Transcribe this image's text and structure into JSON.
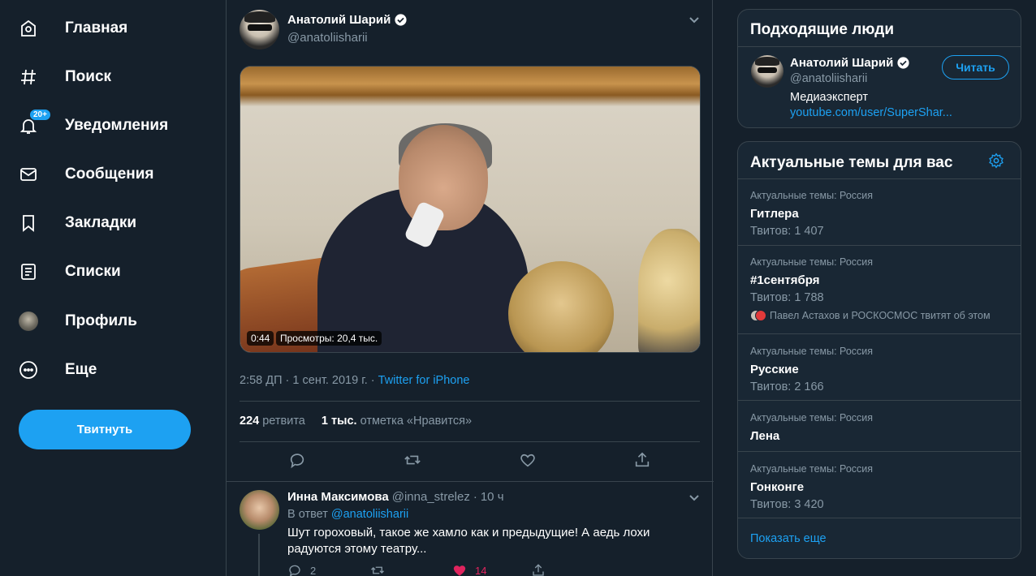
{
  "nav": {
    "home": "Главная",
    "explore": "Поиск",
    "notifications": "Уведомления",
    "notifications_badge": "20+",
    "messages": "Сообщения",
    "bookmarks": "Закладки",
    "lists": "Списки",
    "profile": "Профиль",
    "more": "Еще",
    "tweet_button": "Твитнуть"
  },
  "tweet": {
    "author_name": "Анатолий Шарий",
    "author_handle": "@anatoliisharii",
    "video_duration": "0:44",
    "video_views": "Просмотры: 20,4 тыс.",
    "time": "2:58 ДП",
    "date": "1 сент. 2019 г.",
    "separator": "·",
    "client": "Twitter for iPhone",
    "retweets_count": "224",
    "retweets_label": "ретвита",
    "likes_count": "1 тыс.",
    "likes_label": "отметка «Нравится»"
  },
  "reply": {
    "name": "Инна Максимова",
    "handle": "@inna_strelez",
    "dot": "·",
    "age": "10 ч",
    "in_reply_prefix": "В ответ",
    "in_reply_handle": "@anatoliisharii",
    "text": "Шут гороховый, такое же хамло как и предыдущие! А аедь лохи радуются этому театру...",
    "reply_count": "2",
    "like_count": "14"
  },
  "who_to_follow": {
    "title": "Подходящие люди",
    "name": "Анатолий Шарий",
    "handle": "@anatoliisharii",
    "follow_label": "Читать",
    "bio": "Медиаэксперт",
    "link": "youtube.com/user/SuperShar..."
  },
  "trends": {
    "title": "Актуальные темы для вас",
    "show_more": "Показать еще",
    "items": [
      {
        "context": "Актуальные темы: Россия",
        "name": "Гитлера",
        "count": "Твитов: 1 407"
      },
      {
        "context": "Актуальные темы: Россия",
        "name": "#1сентября",
        "count": "Твитов: 1 788",
        "extra": "Павел Астахов и РОСКОСМОС твитят об этом"
      },
      {
        "context": "Актуальные темы: Россия",
        "name": "Русские",
        "count": "Твитов: 2 166"
      },
      {
        "context": "Актуальные темы: Россия",
        "name": "Лена"
      },
      {
        "context": "Актуальные темы: Россия",
        "name": "Гонконге",
        "count": "Твитов: 3 420"
      }
    ]
  },
  "colors": {
    "background": "#15202b",
    "panel": "#192734",
    "accent": "#1da1f2",
    "muted_text": "#8899a6",
    "like": "#e0245e",
    "border": "#38444d"
  }
}
